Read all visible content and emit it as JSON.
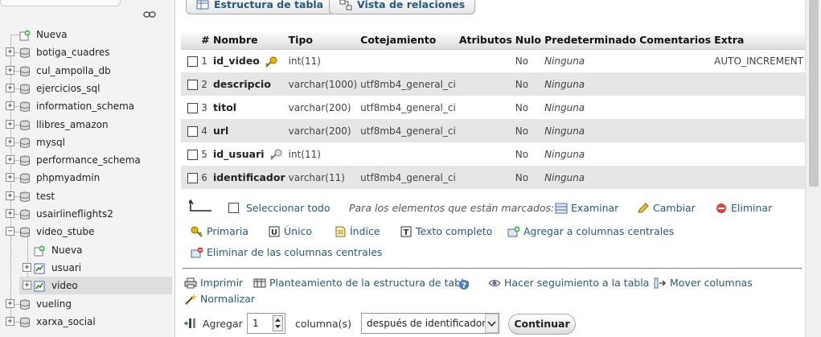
{
  "nav": {
    "items": [
      {
        "label": "Nueva",
        "type": "new"
      },
      {
        "label": "botiga_cuadres",
        "type": "db"
      },
      {
        "label": "cul_ampolla_db",
        "type": "db"
      },
      {
        "label": "ejercicios_sql",
        "type": "db"
      },
      {
        "label": "information_schema",
        "type": "db"
      },
      {
        "label": "llibres_amazon",
        "type": "db"
      },
      {
        "label": "mysql",
        "type": "db"
      },
      {
        "label": "performance_schema",
        "type": "db"
      },
      {
        "label": "phpmyadmin",
        "type": "db"
      },
      {
        "label": "test",
        "type": "db"
      },
      {
        "label": "usairlineflights2",
        "type": "db"
      },
      {
        "label": "video_stube",
        "type": "db-open"
      },
      {
        "label": "Nueva",
        "type": "sub-new"
      },
      {
        "label": "usuari",
        "type": "table"
      },
      {
        "label": "video",
        "type": "table-selected"
      },
      {
        "label": "vueling",
        "type": "db"
      },
      {
        "label": "xarxa_social",
        "type": "db"
      }
    ]
  },
  "tabs": {
    "structure": "Estructura de tabla",
    "relations": "Vista de relaciones"
  },
  "table": {
    "headers": [
      "#",
      "Nombre",
      "Tipo",
      "Cotejamiento",
      "Atributos",
      "Nulo",
      "Predeterminado",
      "Comentarios",
      "Extra"
    ],
    "rows": [
      {
        "num": "1",
        "name": "id_video",
        "key": "primary",
        "type": "int(11)",
        "collation": "",
        "attributes": "",
        "null": "No",
        "default": "Ninguna",
        "comments": "",
        "extra": "AUTO_INCREMENT"
      },
      {
        "num": "2",
        "name": "descripcio",
        "key": "",
        "type": "varchar(1000)",
        "collation": "utf8mb4_general_ci",
        "attributes": "",
        "null": "No",
        "default": "Ninguna",
        "comments": "",
        "extra": ""
      },
      {
        "num": "3",
        "name": "titol",
        "key": "",
        "type": "varchar(200)",
        "collation": "utf8mb4_general_ci",
        "attributes": "",
        "null": "No",
        "default": "Ninguna",
        "comments": "",
        "extra": ""
      },
      {
        "num": "4",
        "name": "url",
        "key": "",
        "type": "varchar(200)",
        "collation": "utf8mb4_general_ci",
        "attributes": "",
        "null": "No",
        "default": "Ninguna",
        "comments": "",
        "extra": ""
      },
      {
        "num": "5",
        "name": "id_usuari",
        "key": "index",
        "type": "int(11)",
        "collation": "",
        "attributes": "",
        "null": "No",
        "default": "Ninguna",
        "comments": "",
        "extra": ""
      },
      {
        "num": "6",
        "name": "identificador",
        "key": "",
        "type": "varchar(11)",
        "collation": "utf8mb4_general_ci",
        "attributes": "",
        "null": "No",
        "default": "Ninguna",
        "comments": "",
        "extra": ""
      }
    ]
  },
  "bulk": {
    "select_all": "Seleccionar todo",
    "marked_label": "Para los elementos que están marcados:",
    "browse": "Examinar",
    "change": "Cambiar",
    "drop": "Eliminar",
    "primary": "Primaria",
    "unique": "Único",
    "index": "Índice",
    "fulltext": "Texto completo",
    "add_central": "Agregar a columnas centrales",
    "remove_central": "Eliminar de las columnas centrales"
  },
  "footer": {
    "print": "Imprimir",
    "propose": "Planteamiento de la estructura de tabla",
    "track": "Hacer seguimiento a la tabla",
    "move": "Mover columnas",
    "normalize": "Normalizar",
    "add_label": "Agregar",
    "add_count": "1",
    "columns_label": "columna(s)",
    "position_selected": "después de identificador",
    "continue_label": "Continuar"
  },
  "colors": {
    "link": "#235a81",
    "row_alt": "#e6e6e6",
    "nav_bg": "#f3f3f3"
  }
}
